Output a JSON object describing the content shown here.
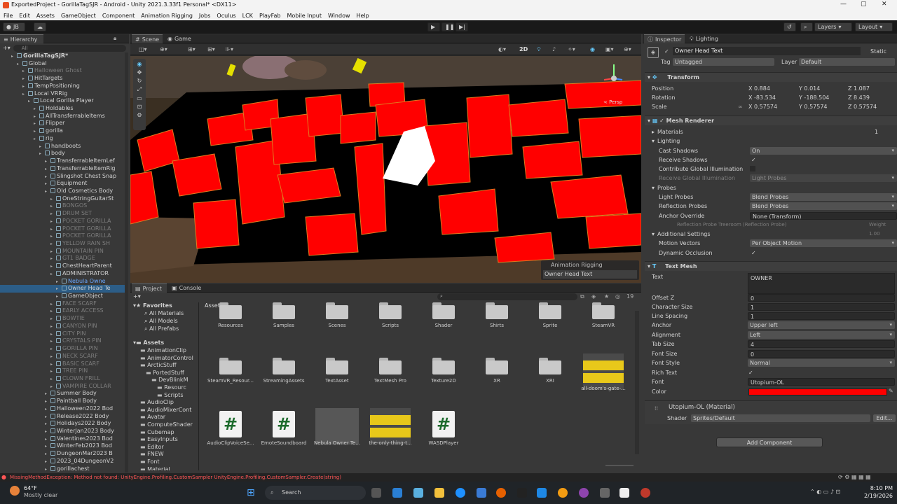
{
  "window": {
    "title": "ExportedProject - GorillaTagSJR - Android - Unity 2021.3.33f1 Personal* <DX11>"
  },
  "menu": [
    "File",
    "Edit",
    "Assets",
    "GameObject",
    "Component",
    "Animation Rigging",
    "Jobs",
    "Oculus",
    "LCK",
    "PlayFab",
    "Mobile Input",
    "Window",
    "Help"
  ],
  "toolbar": {
    "account": "JB",
    "layers": "Layers",
    "layout": "Layout"
  },
  "hierarchy": {
    "tab": "Hierarchy",
    "search_placeholder": "All",
    "rows": [
      {
        "text": "GorillaTagSJR*",
        "indent": 2,
        "style": "bold"
      },
      {
        "text": "Global",
        "indent": 3
      },
      {
        "text": "Halloween Ghost",
        "indent": 4,
        "style": "dim"
      },
      {
        "text": "HitTargets",
        "indent": 4
      },
      {
        "text": "TempPositioning",
        "indent": 4
      },
      {
        "text": "Local VRRig",
        "indent": 4
      },
      {
        "text": "Local Gorilla Player",
        "indent": 5
      },
      {
        "text": "Holdables",
        "indent": 6
      },
      {
        "text": "AllTransferrableItems",
        "indent": 6
      },
      {
        "text": "Flipper",
        "indent": 6
      },
      {
        "text": "gorilla",
        "indent": 6
      },
      {
        "text": "rig",
        "indent": 6
      },
      {
        "text": "handboots",
        "indent": 7
      },
      {
        "text": "body",
        "indent": 7
      },
      {
        "text": "TransferrableItemLef",
        "indent": 8
      },
      {
        "text": "TransferrableItemRig",
        "indent": 8
      },
      {
        "text": "Slingshot Chest Snap",
        "indent": 8
      },
      {
        "text": "Equipment",
        "indent": 8
      },
      {
        "text": "Old Cosmetics Body",
        "indent": 8
      },
      {
        "text": "OneStringGuitarSt",
        "indent": 9
      },
      {
        "text": "BONGOS",
        "indent": 9,
        "style": "dim"
      },
      {
        "text": "DRUM SET",
        "indent": 9,
        "style": "dim"
      },
      {
        "text": "POCKET GORILLA",
        "indent": 9,
        "style": "dim"
      },
      {
        "text": "POCKET GORILLA",
        "indent": 9,
        "style": "dim"
      },
      {
        "text": "POCKET GORILLA",
        "indent": 9,
        "style": "dim"
      },
      {
        "text": "YELLOW RAIN SH",
        "indent": 9,
        "style": "dim"
      },
      {
        "text": "MOUNTAIN PIN",
        "indent": 9,
        "style": "dim"
      },
      {
        "text": "GT1 BADGE",
        "indent": 9,
        "style": "dim"
      },
      {
        "text": "ChestHeartParent",
        "indent": 9
      },
      {
        "text": "ADMINISTRATOR",
        "indent": 9
      },
      {
        "text": "Nebula Owne",
        "indent": 10,
        "style": "blue"
      },
      {
        "text": "Owner Head Te",
        "indent": 10,
        "style": "sel"
      },
      {
        "text": "GameObject",
        "indent": 10
      },
      {
        "text": "FACE SCARF",
        "indent": 9,
        "style": "dim"
      },
      {
        "text": "EARLY ACCESS",
        "indent": 9,
        "style": "dim"
      },
      {
        "text": "BOWTIE",
        "indent": 9,
        "style": "dim"
      },
      {
        "text": "CANYON PIN",
        "indent": 9,
        "style": "dim"
      },
      {
        "text": "CITY PIN",
        "indent": 9,
        "style": "dim"
      },
      {
        "text": "CRYSTALS PIN",
        "indent": 9,
        "style": "dim"
      },
      {
        "text": "GORILLA PIN",
        "indent": 9,
        "style": "dim"
      },
      {
        "text": "NECK SCARF",
        "indent": 9,
        "style": "dim"
      },
      {
        "text": "BASIC SCARF",
        "indent": 9,
        "style": "dim"
      },
      {
        "text": "TREE PIN",
        "indent": 9,
        "style": "dim"
      },
      {
        "text": "CLOWN FRILL",
        "indent": 9,
        "style": "dim"
      },
      {
        "text": "VAMPIRE COLLAR",
        "indent": 9,
        "style": "dim"
      },
      {
        "text": "Summer Body",
        "indent": 8
      },
      {
        "text": "Paintball Body",
        "indent": 8
      },
      {
        "text": "Halloween2022 Bod",
        "indent": 8
      },
      {
        "text": "Release2022 Body",
        "indent": 8
      },
      {
        "text": "Holidays2022 Body",
        "indent": 8
      },
      {
        "text": "WinterJan2023 Body",
        "indent": 8
      },
      {
        "text": "Valentines2023 Bod",
        "indent": 8
      },
      {
        "text": "WinterFeb2023 Bod",
        "indent": 8
      },
      {
        "text": "DungeonMar2023 B",
        "indent": 8
      },
      {
        "text": "2023_04DungeonV2",
        "indent": 8
      },
      {
        "text": "gorillachest",
        "indent": 8
      }
    ]
  },
  "scene": {
    "tabs": [
      "Scene",
      "Game"
    ],
    "persp": "< Persp",
    "overlay_title": "Animation Rigging",
    "overlay_item": "Owner Head Text",
    "mode_2d": "2D"
  },
  "project": {
    "tabs": [
      "Project",
      "Console"
    ],
    "favorites_label": "Favorites",
    "favorites": [
      "All Materials",
      "All Models",
      "All Prefabs"
    ],
    "assets_label": "Assets",
    "tree": [
      {
        "text": "AnimationClip",
        "indent": 1
      },
      {
        "text": "AnimatorControl",
        "indent": 1
      },
      {
        "text": "ArcticStuff",
        "indent": 1
      },
      {
        "text": "PortedStuff",
        "indent": 2
      },
      {
        "text": "DevBlinkM",
        "indent": 3
      },
      {
        "text": "Resourc",
        "indent": 4
      },
      {
        "text": "Scripts",
        "indent": 4
      },
      {
        "text": "AudioClip",
        "indent": 1
      },
      {
        "text": "AudioMixerCont",
        "indent": 1
      },
      {
        "text": "Avatar",
        "indent": 1
      },
      {
        "text": "ComputeShader",
        "indent": 1
      },
      {
        "text": "Cubemap",
        "indent": 1
      },
      {
        "text": "EasyInputs",
        "indent": 1
      },
      {
        "text": "Editor",
        "indent": 1
      },
      {
        "text": "FNEW",
        "indent": 1
      },
      {
        "text": "Font",
        "indent": 1
      },
      {
        "text": "Material",
        "indent": 1
      }
    ],
    "breadcrumb": "Assets",
    "count": "19",
    "row1": [
      "Resources",
      "Samples",
      "Scenes",
      "Scripts",
      "Shader",
      "Shirts",
      "Sprite",
      "SteamVR"
    ],
    "row2": [
      "SteamVR_Resour...",
      "StreamingAssets",
      "TextAsset",
      "TextMesh Pro",
      "Texture2D",
      "XR",
      "XRI",
      "all-doom's-gate-..."
    ],
    "row3": [
      "AudioClipVoiceSe...",
      "EmoteSoundboard",
      "Nebula Owner Te...",
      "the-only-thing-t...",
      "WASDPlayer"
    ]
  },
  "inspector": {
    "tabs": [
      "Inspector",
      "Lighting"
    ],
    "object_name": "Owner Head Text",
    "static": "Static",
    "tag_label": "Tag",
    "tag": "Untagged",
    "layer_label": "Layer",
    "layer": "Default",
    "transform": {
      "title": "Transform",
      "position_label": "Position",
      "rotation_label": "Rotation",
      "scale_label": "Scale",
      "position": [
        "X  0.884",
        "Y  0.014",
        "Z  1.087"
      ],
      "rotation": [
        "X  -83.534",
        "Y  -188.504",
        "Z  8.439"
      ],
      "scale": [
        "X  0.57574",
        "Y  0.57574",
        "Z  0.57574"
      ]
    },
    "mesh_renderer": {
      "title": "Mesh Renderer",
      "materials_label": "Materials",
      "materials_count": "1",
      "lighting_label": "Lighting",
      "cast_shadows_label": "Cast Shadows",
      "cast_shadows": "On",
      "receive_shadows_label": "Receive Shadows",
      "contribute_gi_label": "Contribute Global Illumination",
      "receive_gi_label": "Receive Global Illumination",
      "receive_gi": "Light Probes",
      "probes_label": "Probes",
      "light_probes_label": "Light Probes",
      "light_probes": "Blend Probes",
      "reflection_probes_label": "Reflection Probes",
      "reflection_probes": "Blend Probes",
      "anchor_override_label": "Anchor Override",
      "anchor_override": "None (Transform)",
      "probe_note": "Reflection Probe Treeroom (Reflection Probe)",
      "weight": "Weight 1.00",
      "additional_label": "Additional Settings",
      "motion_vectors_label": "Motion Vectors",
      "motion_vectors": "Per Object Motion",
      "dynamic_occlusion_label": "Dynamic Occlusion"
    },
    "text_mesh": {
      "title": "Text Mesh",
      "text_label": "Text",
      "text": "OWNER",
      "offset_z_label": "Offset Z",
      "offset_z": "0",
      "char_size_label": "Character Size",
      "char_size": "1",
      "line_spacing_label": "Line Spacing",
      "line_spacing": "1",
      "anchor_label": "Anchor",
      "anchor": "Upper left",
      "alignment_label": "Alignment",
      "alignment": "Left",
      "tab_size_label": "Tab Size",
      "tab_size": "4",
      "font_size_label": "Font Size",
      "font_size": "0",
      "font_style_label": "Font Style",
      "font_style": "Normal",
      "rich_text_label": "Rich Text",
      "font_label": "Font",
      "font": "Utopium-OL",
      "color_label": "Color",
      "color": "#ff0000"
    },
    "material": {
      "name": "Utopium-OL (Material)",
      "shader_label": "Shader",
      "shader": "Sprites/Default",
      "edit": "Edit..."
    },
    "add_component": "Add Component"
  },
  "status": {
    "error": "MissingMethodException: Method not found: UnityEngine.Profiling.CustomSampler UnityEngine.Profiling.CustomSampler.Create(string)"
  },
  "taskbar": {
    "temp": "64°F",
    "weather": "Mostly clear",
    "search": "Search",
    "time": "8:10 PM",
    "date": "2/19/2026"
  },
  "colors": {
    "accent": "#2c5d87",
    "error": "#ff5555",
    "scene_red": "#ff0000"
  }
}
